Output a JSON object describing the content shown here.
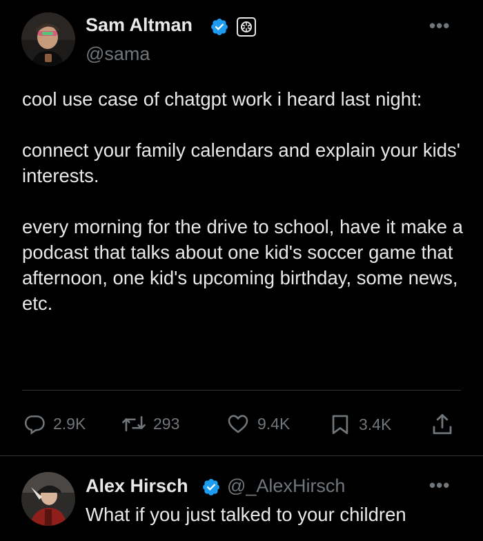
{
  "tweet": {
    "author_name": "Sam Altman",
    "author_handle": "@sama",
    "verified_icon": "verified-badge-icon",
    "affiliation_icon": "openai-logo-icon",
    "more_label": "•••",
    "paragraphs": [
      "cool use case of chatgpt work i heard last night:",
      "connect your family calendars and explain your kids' interests.",
      "every morning for the drive to school, have it make a podcast that talks about one kid's soccer game that afternoon, one kid's upcoming birthday, some news, etc."
    ],
    "actions": {
      "replies": "2.9K",
      "reposts": "293",
      "likes": "9.4K",
      "bookmarks": "3.4K"
    }
  },
  "reply": {
    "author_name": "Alex Hirsch",
    "author_handle": "@_AlexHirsch",
    "more_label": "•••",
    "text": "What if you just talked to your children"
  },
  "colors": {
    "background": "#000000",
    "text": "#e7e9ea",
    "muted": "#71767b",
    "verified": "#1d9bf0",
    "divider": "#2f3336"
  }
}
